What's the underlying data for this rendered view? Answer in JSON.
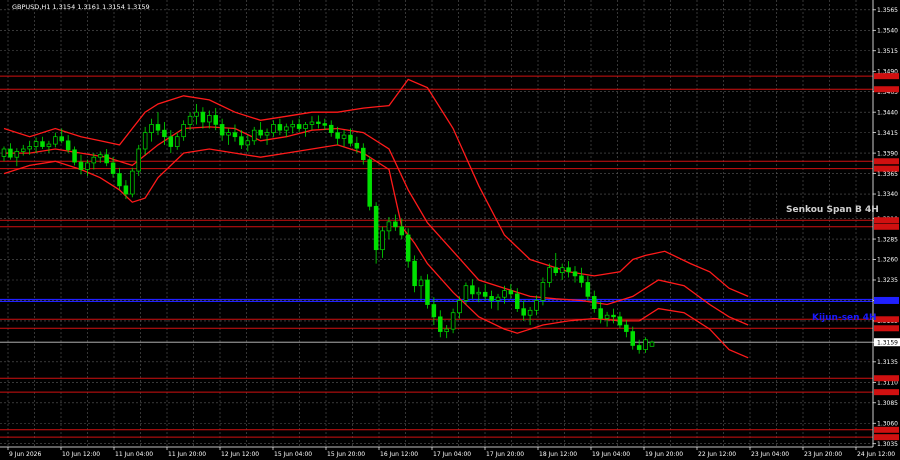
{
  "chart_data": {
    "type": "candlestick",
    "title": "GBPUSD,H1  1.3154 1.3161 1.3154 1.3159",
    "ylim": [
      1.3031,
      1.3577
    ],
    "y_ticks": [
      "1.3565",
      "1.3540",
      "1.3515",
      "1.3490",
      "1.3465",
      "1.3440",
      "1.3415",
      "1.3390",
      "1.3365",
      "1.3340",
      "1.3310",
      "1.3285",
      "1.3260",
      "1.3235",
      "1.3210",
      "1.3185",
      "1.3159",
      "1.3135",
      "1.3110",
      "1.3085",
      "1.3060",
      "1.3035"
    ],
    "x_ticks": [
      "9 Jun 2026",
      "10 Jun 12:00",
      "11 Jun 04:00",
      "11 Jun 20:00",
      "12 Jun 12:00",
      "15 Jun 04:00",
      "15 Jun 20:00",
      "16 Jun 12:00",
      "17 Jun 04:00",
      "17 Jun 20:00",
      "18 Jun 12:00",
      "19 Jun 04:00",
      "19 Jun 20:00",
      "22 Jun 12:00",
      "23 Jun 04:00",
      "23 Jun 20:00",
      "24 Jun 12:00"
    ],
    "current_price": 1.3159,
    "annotations": [
      {
        "text": "Senkou Span B 4H",
        "color": "#d0d0d0"
      },
      {
        "text": "Kijun-sen 4H",
        "color": "#1a1aff"
      }
    ],
    "levels": [
      {
        "price": 1.3484,
        "color": "#d01010"
      },
      {
        "price": 1.3468,
        "color": "#d01010"
      },
      {
        "price": 1.338,
        "color": "#d01010"
      },
      {
        "price": 1.3371,
        "color": "#d01010"
      },
      {
        "price": 1.3308,
        "color": "#d01010"
      },
      {
        "price": 1.33,
        "color": "#d01010"
      },
      {
        "price": 1.3187,
        "color": "#d01010"
      },
      {
        "price": 1.3176,
        "color": "#d01010"
      },
      {
        "price": 1.3115,
        "color": "#d01010"
      },
      {
        "price": 1.3098,
        "color": "#d01010"
      },
      {
        "price": 1.3052,
        "color": "#d01010"
      },
      {
        "price": 1.3043,
        "color": "#d01010"
      }
    ],
    "blue_line": 1.321,
    "series": [
      {
        "name": "upper",
        "color": "#ff1a1a",
        "points": [
          [
            0,
            1.342
          ],
          [
            4,
            1.341
          ],
          [
            8,
            1.342
          ],
          [
            12,
            1.341
          ],
          [
            15,
            1.3405
          ],
          [
            18,
            1.34
          ],
          [
            20,
            1.342
          ],
          [
            22,
            1.344
          ],
          [
            24,
            1.345
          ],
          [
            28,
            1.346
          ],
          [
            32,
            1.3455
          ],
          [
            36,
            1.344
          ],
          [
            40,
            1.343
          ],
          [
            44,
            1.3435
          ],
          [
            48,
            1.344
          ],
          [
            52,
            1.344
          ],
          [
            56,
            1.3445
          ],
          [
            60,
            1.3448
          ],
          [
            63,
            1.348
          ],
          [
            66,
            1.347
          ],
          [
            70,
            1.342
          ],
          [
            74,
            1.335
          ],
          [
            78,
            1.329
          ],
          [
            82,
            1.326
          ],
          [
            84,
            1.3255
          ],
          [
            88,
            1.3245
          ],
          [
            92,
            1.324
          ],
          [
            96,
            1.3245
          ],
          [
            98,
            1.326
          ],
          [
            100,
            1.3265
          ],
          [
            103,
            1.327
          ],
          [
            107,
            1.3255
          ],
          [
            110,
            1.3245
          ],
          [
            113,
            1.3225
          ],
          [
            116,
            1.3215
          ]
        ]
      },
      {
        "name": "lower",
        "color": "#ff1a1a",
        "points": [
          [
            0,
            1.3365
          ],
          [
            4,
            1.3375
          ],
          [
            8,
            1.338
          ],
          [
            12,
            1.337
          ],
          [
            15,
            1.336
          ],
          [
            18,
            1.3345
          ],
          [
            20,
            1.333
          ],
          [
            22,
            1.3335
          ],
          [
            24,
            1.336
          ],
          [
            28,
            1.339
          ],
          [
            32,
            1.3395
          ],
          [
            36,
            1.339
          ],
          [
            40,
            1.3385
          ],
          [
            44,
            1.339
          ],
          [
            48,
            1.3395
          ],
          [
            52,
            1.34
          ],
          [
            56,
            1.339
          ],
          [
            60,
            1.337
          ],
          [
            62,
            1.33
          ],
          [
            64,
            1.328
          ],
          [
            66,
            1.3255
          ],
          [
            70,
            1.322
          ],
          [
            74,
            1.319
          ],
          [
            78,
            1.3175
          ],
          [
            80,
            1.317
          ],
          [
            84,
            1.318
          ],
          [
            88,
            1.3185
          ],
          [
            92,
            1.3188
          ],
          [
            96,
            1.3185
          ],
          [
            99,
            1.3185
          ],
          [
            102,
            1.32
          ],
          [
            106,
            1.3195
          ],
          [
            110,
            1.3175
          ],
          [
            113,
            1.315
          ],
          [
            116,
            1.314
          ]
        ]
      },
      {
        "name": "middle",
        "color": "#ff1a1a",
        "points": [
          [
            0,
            1.339
          ],
          [
            4,
            1.339
          ],
          [
            8,
            1.3395
          ],
          [
            12,
            1.339
          ],
          [
            16,
            1.3385
          ],
          [
            20,
            1.3375
          ],
          [
            24,
            1.34
          ],
          [
            28,
            1.342
          ],
          [
            32,
            1.3422
          ],
          [
            36,
            1.342
          ],
          [
            40,
            1.3405
          ],
          [
            44,
            1.341
          ],
          [
            48,
            1.3418
          ],
          [
            52,
            1.342
          ],
          [
            56,
            1.3415
          ],
          [
            60,
            1.3395
          ],
          [
            63,
            1.3345
          ],
          [
            66,
            1.3305
          ],
          [
            70,
            1.327
          ],
          [
            74,
            1.3235
          ],
          [
            78,
            1.3225
          ],
          [
            82,
            1.3215
          ],
          [
            86,
            1.3212
          ],
          [
            90,
            1.321
          ],
          [
            94,
            1.3205
          ],
          [
            98,
            1.3215
          ],
          [
            102,
            1.3235
          ],
          [
            106,
            1.3228
          ],
          [
            110,
            1.3205
          ],
          [
            113,
            1.319
          ],
          [
            116,
            1.318
          ]
        ]
      }
    ],
    "candles": [
      [
        1.3386,
        1.3398,
        1.338,
        1.3395
      ],
      [
        1.3395,
        1.3402,
        1.3382,
        1.3385
      ],
      [
        1.3385,
        1.3396,
        1.3374,
        1.3392
      ],
      [
        1.3392,
        1.34,
        1.3387,
        1.3395
      ],
      [
        1.3395,
        1.3405,
        1.3388,
        1.3398
      ],
      [
        1.3398,
        1.3409,
        1.339,
        1.3404
      ],
      [
        1.3404,
        1.341,
        1.3395,
        1.3398
      ],
      [
        1.3398,
        1.3405,
        1.339,
        1.3401
      ],
      [
        1.3401,
        1.3415,
        1.3397,
        1.341
      ],
      [
        1.341,
        1.342,
        1.3402,
        1.3405
      ],
      [
        1.3405,
        1.3412,
        1.339,
        1.3394
      ],
      [
        1.3394,
        1.3398,
        1.3375,
        1.3379
      ],
      [
        1.3379,
        1.3388,
        1.3364,
        1.337
      ],
      [
        1.337,
        1.3382,
        1.3362,
        1.3378
      ],
      [
        1.3378,
        1.339,
        1.337,
        1.3385
      ],
      [
        1.3385,
        1.3392,
        1.3378,
        1.3388
      ],
      [
        1.3388,
        1.3395,
        1.3374,
        1.3378
      ],
      [
        1.3378,
        1.3385,
        1.336,
        1.3365
      ],
      [
        1.3365,
        1.3372,
        1.3345,
        1.335
      ],
      [
        1.335,
        1.3357,
        1.3334,
        1.334
      ],
      [
        1.334,
        1.3372,
        1.3336,
        1.3368
      ],
      [
        1.3368,
        1.34,
        1.3362,
        1.3395
      ],
      [
        1.3395,
        1.3422,
        1.3388,
        1.3415
      ],
      [
        1.3415,
        1.3432,
        1.3404,
        1.3425
      ],
      [
        1.3425,
        1.344,
        1.3412,
        1.3418
      ],
      [
        1.3418,
        1.3428,
        1.34,
        1.341
      ],
      [
        1.341,
        1.3418,
        1.339,
        1.3398
      ],
      [
        1.3398,
        1.3415,
        1.3394,
        1.341
      ],
      [
        1.341,
        1.343,
        1.3405,
        1.3425
      ],
      [
        1.3425,
        1.344,
        1.3418,
        1.3435
      ],
      [
        1.3435,
        1.345,
        1.3425,
        1.344
      ],
      [
        1.344,
        1.3446,
        1.342,
        1.3428
      ],
      [
        1.3428,
        1.3442,
        1.342,
        1.3436
      ],
      [
        1.3436,
        1.3445,
        1.3418,
        1.3425
      ],
      [
        1.3425,
        1.3432,
        1.3405,
        1.3412
      ],
      [
        1.3412,
        1.342,
        1.34,
        1.3415
      ],
      [
        1.3415,
        1.3425,
        1.3404,
        1.341
      ],
      [
        1.341,
        1.3418,
        1.3395,
        1.34
      ],
      [
        1.34,
        1.3412,
        1.3392,
        1.3405
      ],
      [
        1.3405,
        1.3422,
        1.34,
        1.3418
      ],
      [
        1.3418,
        1.3428,
        1.3408,
        1.3412
      ],
      [
        1.3412,
        1.342,
        1.34,
        1.3415
      ],
      [
        1.3415,
        1.343,
        1.341,
        1.3425
      ],
      [
        1.3425,
        1.3432,
        1.3412,
        1.3418
      ],
      [
        1.3418,
        1.3426,
        1.341,
        1.3422
      ],
      [
        1.3422,
        1.343,
        1.3414,
        1.3425
      ],
      [
        1.3425,
        1.3432,
        1.3416,
        1.342
      ],
      [
        1.342,
        1.3428,
        1.341,
        1.3425
      ],
      [
        1.3425,
        1.3435,
        1.3418,
        1.3428
      ],
      [
        1.3428,
        1.3436,
        1.342,
        1.3426
      ],
      [
        1.3426,
        1.3432,
        1.3418,
        1.3424
      ],
      [
        1.3424,
        1.343,
        1.341,
        1.3415
      ],
      [
        1.3415,
        1.3422,
        1.34,
        1.3408
      ],
      [
        1.3408,
        1.3418,
        1.3398,
        1.3412
      ],
      [
        1.3412,
        1.342,
        1.3398,
        1.3402
      ],
      [
        1.3402,
        1.341,
        1.339,
        1.3396
      ],
      [
        1.3396,
        1.3402,
        1.3376,
        1.3382
      ],
      [
        1.3382,
        1.3386,
        1.332,
        1.3325
      ],
      [
        1.3325,
        1.333,
        1.3255,
        1.3272
      ],
      [
        1.3272,
        1.33,
        1.3262,
        1.3295
      ],
      [
        1.3295,
        1.3312,
        1.3285,
        1.3306
      ],
      [
        1.3306,
        1.3315,
        1.3295,
        1.33
      ],
      [
        1.33,
        1.331,
        1.3285,
        1.329
      ],
      [
        1.329,
        1.3298,
        1.325,
        1.3258
      ],
      [
        1.3258,
        1.3265,
        1.322,
        1.3228
      ],
      [
        1.3228,
        1.324,
        1.3212,
        1.3235
      ],
      [
        1.3235,
        1.3242,
        1.32,
        1.3205
      ],
      [
        1.3205,
        1.3214,
        1.318,
        1.319
      ],
      [
        1.319,
        1.3198,
        1.3165,
        1.3172
      ],
      [
        1.3172,
        1.318,
        1.3164,
        1.3175
      ],
      [
        1.3175,
        1.32,
        1.317,
        1.3195
      ],
      [
        1.3195,
        1.3215,
        1.3188,
        1.321
      ],
      [
        1.321,
        1.3232,
        1.3205,
        1.3228
      ],
      [
        1.3228,
        1.3236,
        1.3212,
        1.3218
      ],
      [
        1.3218,
        1.3226,
        1.3208,
        1.322
      ],
      [
        1.322,
        1.323,
        1.321,
        1.3215
      ],
      [
        1.3215,
        1.3222,
        1.32,
        1.321
      ],
      [
        1.321,
        1.3218,
        1.3198,
        1.3214
      ],
      [
        1.3214,
        1.3228,
        1.3206,
        1.3222
      ],
      [
        1.3222,
        1.323,
        1.3212,
        1.3218
      ],
      [
        1.3218,
        1.3225,
        1.3196,
        1.32
      ],
      [
        1.32,
        1.321,
        1.3185,
        1.3192
      ],
      [
        1.3192,
        1.3202,
        1.318,
        1.3198
      ],
      [
        1.3198,
        1.3216,
        1.3192,
        1.321
      ],
      [
        1.321,
        1.3238,
        1.3204,
        1.3232
      ],
      [
        1.3232,
        1.3255,
        1.3226,
        1.325
      ],
      [
        1.325,
        1.3268,
        1.324,
        1.3244
      ],
      [
        1.3244,
        1.3255,
        1.3235,
        1.325
      ],
      [
        1.325,
        1.3258,
        1.3238,
        1.3245
      ],
      [
        1.3245,
        1.3252,
        1.3232,
        1.324
      ],
      [
        1.324,
        1.325,
        1.3226,
        1.3232
      ],
      [
        1.3232,
        1.324,
        1.321,
        1.3215
      ],
      [
        1.3215,
        1.3222,
        1.3195,
        1.32
      ],
      [
        1.32,
        1.3208,
        1.3182,
        1.3188
      ],
      [
        1.3188,
        1.3196,
        1.3178,
        1.3192
      ],
      [
        1.3192,
        1.32,
        1.3182,
        1.319
      ],
      [
        1.319,
        1.3196,
        1.3176,
        1.318
      ],
      [
        1.318,
        1.3186,
        1.3165,
        1.3172
      ],
      [
        1.3172,
        1.3178,
        1.315,
        1.3155
      ],
      [
        1.3155,
        1.3162,
        1.3145,
        1.315
      ],
      [
        1.315,
        1.3165,
        1.3146,
        1.3162
      ],
      [
        1.3154,
        1.3161,
        1.3154,
        1.3159
      ]
    ],
    "grid": true,
    "legend": "none"
  }
}
